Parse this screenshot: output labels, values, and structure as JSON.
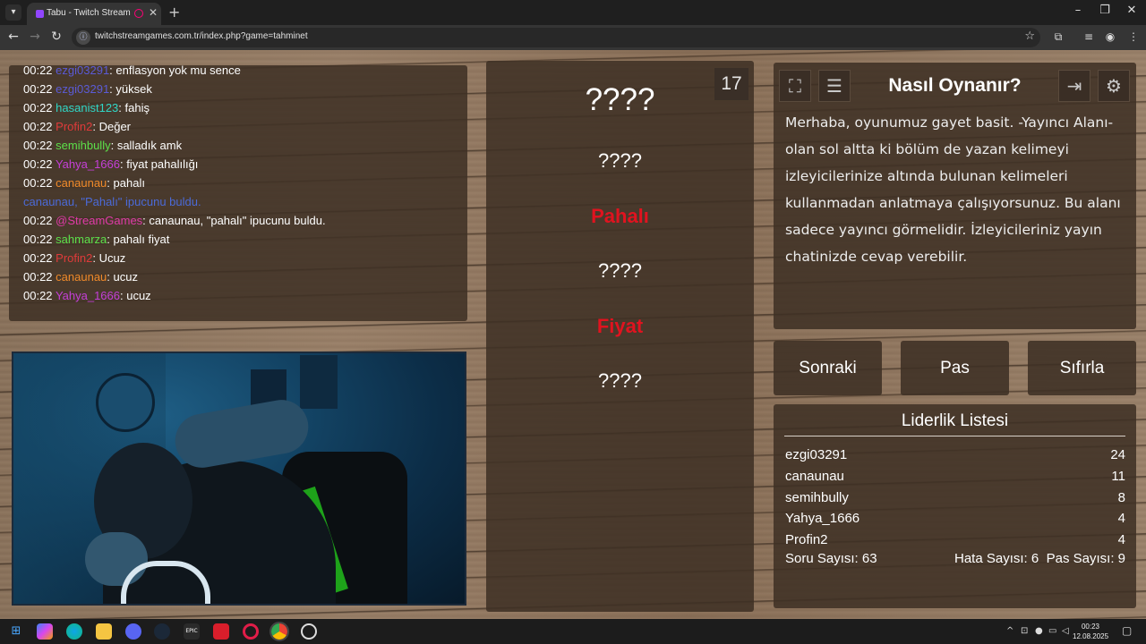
{
  "browser": {
    "tab_title": "Tabu - Twitch Stream Games",
    "url": "twitchstreamgames.com.tr/index.php?game=tahminet",
    "icons": [
      "tab-menu-icon",
      "audio-icon",
      "close-icon",
      "new-tab-icon",
      "back-icon",
      "forward-icon",
      "reload-icon",
      "site-info-icon",
      "star-icon",
      "extensions-icon",
      "media-icon",
      "profile-icon",
      "menu-icon"
    ]
  },
  "chat": {
    "lines": [
      {
        "time": "00:22",
        "user": "ezgi03291",
        "text": ": enflasyon yok mu sence",
        "color": "#5b5bd6"
      },
      {
        "time": "00:22",
        "user": "ezgi03291",
        "text": ": yüksek",
        "color": "#5b5bd6"
      },
      {
        "time": "00:22",
        "user": "hasanist123",
        "text": ": fahiş",
        "color": "#2fd6c6"
      },
      {
        "time": "00:22",
        "user": "Profin2",
        "text": ": Değer",
        "color": "#e03a3a"
      },
      {
        "time": "00:22",
        "user": "semihbully",
        "text": ": salladık amk",
        "color": "#5ce04a"
      },
      {
        "time": "00:22",
        "user": "Yahya_1666",
        "text": ": fiyat pahalılığı",
        "color": "#c43fd8"
      },
      {
        "time": "00:22",
        "user": "canaunau",
        "text": ": pahalı",
        "color": "#f08a2a"
      },
      {
        "time": "",
        "user": "canaunau, \"Pahalı\" ipucunu buldu.",
        "text": "",
        "color": "#4b6ad8"
      },
      {
        "time": "00:22",
        "user": "@StreamGames",
        "text": ": canaunau, \"pahalı\" ipucunu buldu.",
        "color": "#e03aa8"
      },
      {
        "time": "00:22",
        "user": "sahmarza",
        "text": ": pahalı fiyat",
        "color": "#5ce04a"
      },
      {
        "time": "00:22",
        "user": "Profin2",
        "text": ": Ucuz",
        "color": "#e03a3a"
      },
      {
        "time": "00:22",
        "user": "canaunau",
        "text": ": ucuz",
        "color": "#f08a2a"
      },
      {
        "time": "00:22",
        "user": "Yahya_1666",
        "text": ": ucuz",
        "color": "#c43fd8"
      }
    ]
  },
  "words": {
    "counter": "17",
    "main": "????",
    "clues": [
      {
        "text": "????",
        "found": false
      },
      {
        "text": "Pahalı",
        "found": true
      },
      {
        "text": "????",
        "found": false
      },
      {
        "text": "Fiyat",
        "found": true
      },
      {
        "text": "????",
        "found": false
      }
    ]
  },
  "info": {
    "title": "Nasıl Oynanır?",
    "text": "Merhaba, oyunumuz gayet basit. -Yayıncı Alanı- olan sol altta ki bölüm de yazan kelimeyi izleyicilerinize altında bulunan kelimeleri kullanmadan anlatmaya çalışıyorsunuz. Bu alanı sadece yayıncı görmelidir. İzleyicileriniz yayın chatinizde cevap verebilir.",
    "icons": [
      "fullscreen-icon",
      "notes-icon",
      "exit-icon",
      "settings-icon"
    ]
  },
  "actions": {
    "next": "Sonraki",
    "pass": "Pas",
    "reset": "Sıfırla"
  },
  "leaderboard": {
    "title": "Liderlik Listesi",
    "rows": [
      {
        "name": "ezgi03291",
        "score": "24"
      },
      {
        "name": "canaunau",
        "score": "11"
      },
      {
        "name": "semihbully",
        "score": "8"
      },
      {
        "name": "Yahya_1666",
        "score": "4"
      },
      {
        "name": "Profin2",
        "score": "4"
      }
    ],
    "questions": "Soru Sayısı: 63",
    "errors": "Hata Sayısı: 6",
    "passes": "Pas Sayısı: 9"
  },
  "taskbar": {
    "time": "00:23",
    "date": "12.08.2025",
    "apps": [
      "start-icon",
      "copilot-icon",
      "edge-icon",
      "file-explorer-icon",
      "discord-icon",
      "steam-icon",
      "epic-games-icon",
      "app-red-icon",
      "opera-icon",
      "chrome-icon",
      "app-speed-icon"
    ],
    "epic_label": "EPIC"
  },
  "colors": {
    "found_word": "#e0131f",
    "panel": "#3e3024"
  }
}
